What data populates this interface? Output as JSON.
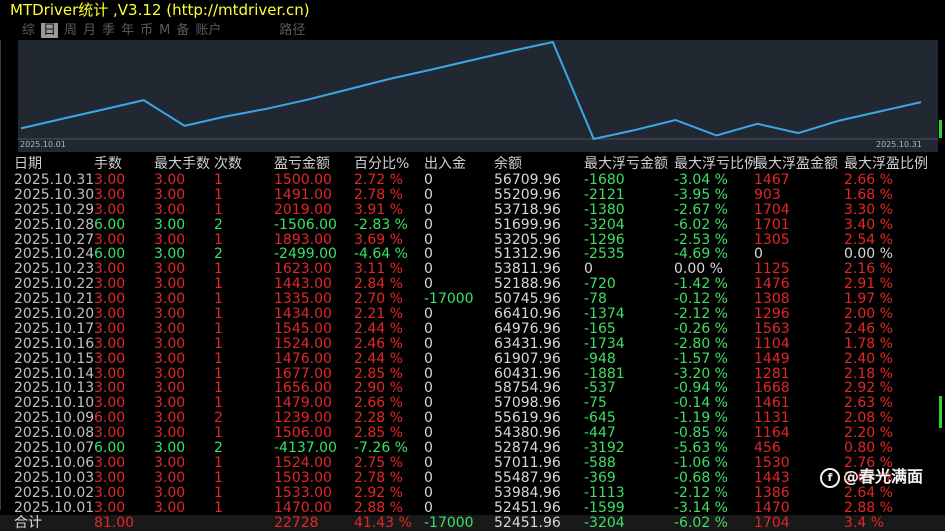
{
  "window": {
    "title": "MTDriver统计 ,V3.12 (http://mtdriver.cn)"
  },
  "tabs": [
    {
      "label": "综",
      "active": false
    },
    {
      "label": "日",
      "active": true
    },
    {
      "label": "周",
      "active": false
    },
    {
      "label": "月",
      "active": false
    },
    {
      "label": "季",
      "active": false
    },
    {
      "label": "年",
      "active": false
    },
    {
      "label": "币",
      "active": false
    },
    {
      "label": "M",
      "active": false
    },
    {
      "label": "备",
      "active": false
    },
    {
      "label": "账户",
      "active": false
    },
    {
      "label": "路径",
      "active": false
    }
  ],
  "chart_data": {
    "type": "line",
    "x_start_label": "2025.10.01",
    "x_end_label": "2025.10.31",
    "color": "#3aa8e8",
    "values": [
      52451.96,
      53984.96,
      55487.96,
      57011.96,
      52874.96,
      54380.96,
      55619.96,
      57098.96,
      58754.96,
      60431.96,
      61907.96,
      63431.96,
      64976.96,
      66410.96,
      50745.96,
      52188.96,
      53811.96,
      51312.96,
      53205.96,
      51699.96,
      53718.96,
      55209.96,
      56709.96
    ]
  },
  "table": {
    "headers": [
      "日期",
      "手数",
      "最大手数",
      "次数",
      "盈亏金额",
      "百分比%",
      "出入金",
      "余额",
      "最大浮亏金额",
      "最大浮亏比例",
      "最大浮盈金额",
      "最大浮盈比例"
    ],
    "rows": [
      {
        "date": "2025.10.31",
        "lots": "3.00",
        "max_lots": "3.00",
        "count": "1",
        "pnl": "1500.00",
        "pct": "2.72 %",
        "io": "0",
        "balance": "56709.96",
        "mfl": "-1680",
        "mflp": "-3.04 %",
        "mfp": "1467",
        "mfpp": "2.66 %",
        "tone": "red"
      },
      {
        "date": "2025.10.30",
        "lots": "3.00",
        "max_lots": "3.00",
        "count": "1",
        "pnl": "1491.00",
        "pct": "2.78 %",
        "io": "0",
        "balance": "55209.96",
        "mfl": "-2121",
        "mflp": "-3.95 %",
        "mfp": "903",
        "mfpp": "1.68 %",
        "tone": "red"
      },
      {
        "date": "2025.10.29",
        "lots": "3.00",
        "max_lots": "3.00",
        "count": "1",
        "pnl": "2019.00",
        "pct": "3.91 %",
        "io": "0",
        "balance": "53718.96",
        "mfl": "-1380",
        "mflp": "-2.67 %",
        "mfp": "1704",
        "mfpp": "3.30 %",
        "tone": "red"
      },
      {
        "date": "2025.10.28",
        "lots": "6.00",
        "max_lots": "3.00",
        "count": "2",
        "pnl": "-1506.00",
        "pct": "-2.83 %",
        "io": "0",
        "balance": "51699.96",
        "mfl": "-3204",
        "mflp": "-6.02 %",
        "mfp": "1701",
        "mfpp": "3.40 %",
        "tone": "green"
      },
      {
        "date": "2025.10.27",
        "lots": "3.00",
        "max_lots": "3.00",
        "count": "1",
        "pnl": "1893.00",
        "pct": "3.69 %",
        "io": "0",
        "balance": "53205.96",
        "mfl": "-1296",
        "mflp": "-2.53 %",
        "mfp": "1305",
        "mfpp": "2.54 %",
        "tone": "red"
      },
      {
        "date": "2025.10.24",
        "lots": "6.00",
        "max_lots": "3.00",
        "count": "2",
        "pnl": "-2499.00",
        "pct": "-4.64 %",
        "io": "0",
        "balance": "51312.96",
        "mfl": "-2535",
        "mflp": "-4.69 %",
        "mfp": "0",
        "mfpp": "0.00 %",
        "tone": "green"
      },
      {
        "date": "2025.10.23",
        "lots": "3.00",
        "max_lots": "3.00",
        "count": "1",
        "pnl": "1623.00",
        "pct": "3.11 %",
        "io": "0",
        "balance": "53811.96",
        "mfl": "0",
        "mflp": "0.00 %",
        "mfp": "1125",
        "mfpp": "2.16 %",
        "tone": "red"
      },
      {
        "date": "2025.10.22",
        "lots": "3.00",
        "max_lots": "3.00",
        "count": "1",
        "pnl": "1443.00",
        "pct": "2.84 %",
        "io": "0",
        "balance": "52188.96",
        "mfl": "-720",
        "mflp": "-1.42 %",
        "mfp": "1476",
        "mfpp": "2.91 %",
        "tone": "red"
      },
      {
        "date": "2025.10.21",
        "lots": "3.00",
        "max_lots": "3.00",
        "count": "1",
        "pnl": "1335.00",
        "pct": "2.70 %",
        "io": "-17000",
        "balance": "50745.96",
        "mfl": "-78",
        "mflp": "-0.12 %",
        "mfp": "1308",
        "mfpp": "1.97 %",
        "tone": "red"
      },
      {
        "date": "2025.10.20",
        "lots": "3.00",
        "max_lots": "3.00",
        "count": "1",
        "pnl": "1434.00",
        "pct": "2.21 %",
        "io": "0",
        "balance": "66410.96",
        "mfl": "-1374",
        "mflp": "-2.12 %",
        "mfp": "1296",
        "mfpp": "2.00 %",
        "tone": "red"
      },
      {
        "date": "2025.10.17",
        "lots": "3.00",
        "max_lots": "3.00",
        "count": "1",
        "pnl": "1545.00",
        "pct": "2.44 %",
        "io": "0",
        "balance": "64976.96",
        "mfl": "-165",
        "mflp": "-0.26 %",
        "mfp": "1563",
        "mfpp": "2.46 %",
        "tone": "red"
      },
      {
        "date": "2025.10.16",
        "lots": "3.00",
        "max_lots": "3.00",
        "count": "1",
        "pnl": "1524.00",
        "pct": "2.46 %",
        "io": "0",
        "balance": "63431.96",
        "mfl": "-1734",
        "mflp": "-2.80 %",
        "mfp": "1104",
        "mfpp": "1.78 %",
        "tone": "red"
      },
      {
        "date": "2025.10.15",
        "lots": "3.00",
        "max_lots": "3.00",
        "count": "1",
        "pnl": "1476.00",
        "pct": "2.44 %",
        "io": "0",
        "balance": "61907.96",
        "mfl": "-948",
        "mflp": "-1.57 %",
        "mfp": "1449",
        "mfpp": "2.40 %",
        "tone": "red"
      },
      {
        "date": "2025.10.14",
        "lots": "3.00",
        "max_lots": "3.00",
        "count": "1",
        "pnl": "1677.00",
        "pct": "2.85 %",
        "io": "0",
        "balance": "60431.96",
        "mfl": "-1881",
        "mflp": "-3.20 %",
        "mfp": "1281",
        "mfpp": "2.18 %",
        "tone": "red"
      },
      {
        "date": "2025.10.13",
        "lots": "3.00",
        "max_lots": "3.00",
        "count": "1",
        "pnl": "1656.00",
        "pct": "2.90 %",
        "io": "0",
        "balance": "58754.96",
        "mfl": "-537",
        "mflp": "-0.94 %",
        "mfp": "1668",
        "mfpp": "2.92 %",
        "tone": "red"
      },
      {
        "date": "2025.10.10",
        "lots": "3.00",
        "max_lots": "3.00",
        "count": "1",
        "pnl": "1479.00",
        "pct": "2.66 %",
        "io": "0",
        "balance": "57098.96",
        "mfl": "-75",
        "mflp": "-0.14 %",
        "mfp": "1461",
        "mfpp": "2.63 %",
        "tone": "red"
      },
      {
        "date": "2025.10.09",
        "lots": "6.00",
        "max_lots": "3.00",
        "count": "2",
        "pnl": "1239.00",
        "pct": "2.28 %",
        "io": "0",
        "balance": "55619.96",
        "mfl": "-645",
        "mflp": "-1.19 %",
        "mfp": "1131",
        "mfpp": "2.08 %",
        "tone": "red"
      },
      {
        "date": "2025.10.08",
        "lots": "3.00",
        "max_lots": "3.00",
        "count": "1",
        "pnl": "1506.00",
        "pct": "2.85 %",
        "io": "0",
        "balance": "54380.96",
        "mfl": "-447",
        "mflp": "-0.85 %",
        "mfp": "1164",
        "mfpp": "2.20 %",
        "tone": "red"
      },
      {
        "date": "2025.10.07",
        "lots": "6.00",
        "max_lots": "3.00",
        "count": "2",
        "pnl": "-4137.00",
        "pct": "-7.26 %",
        "io": "0",
        "balance": "52874.96",
        "mfl": "-3192",
        "mflp": "-5.63 %",
        "mfp": "456",
        "mfpp": "0.80 %",
        "tone": "green"
      },
      {
        "date": "2025.10.06",
        "lots": "3.00",
        "max_lots": "3.00",
        "count": "1",
        "pnl": "1524.00",
        "pct": "2.75 %",
        "io": "0",
        "balance": "57011.96",
        "mfl": "-588",
        "mflp": "-1.06 %",
        "mfp": "1530",
        "mfpp": "2.76 %",
        "tone": "red"
      },
      {
        "date": "2025.10.03",
        "lots": "3.00",
        "max_lots": "3.00",
        "count": "1",
        "pnl": "1503.00",
        "pct": "2.78 %",
        "io": "0",
        "balance": "55487.96",
        "mfl": "-369",
        "mflp": "-0.68 %",
        "mfp": "1443",
        "mfpp": "2.67 %",
        "tone": "red"
      },
      {
        "date": "2025.10.02",
        "lots": "3.00",
        "max_lots": "3.00",
        "count": "1",
        "pnl": "1533.00",
        "pct": "2.92 %",
        "io": "0",
        "balance": "53984.96",
        "mfl": "-1113",
        "mflp": "-2.12 %",
        "mfp": "1386",
        "mfpp": "2.64 %",
        "tone": "red"
      },
      {
        "date": "2025.10.01",
        "lots": "3.00",
        "max_lots": "3.00",
        "count": "1",
        "pnl": "1470.00",
        "pct": "2.88 %",
        "io": "0",
        "balance": "52451.96",
        "mfl": "-1599",
        "mflp": "-3.14 %",
        "mfp": "1470",
        "mfpp": "2.88 %",
        "tone": "red"
      }
    ],
    "total": {
      "label": "合计",
      "lots": "81.00",
      "pnl": "22728",
      "pct": "41.43 %",
      "io": "-17000",
      "balance": "52451.96",
      "mfl": "-3204",
      "mflp": "-6.02 %",
      "mfp": "1704",
      "mfpp": "3.4 %"
    }
  },
  "watermark": {
    "text": "@春光满面"
  },
  "colors": {
    "profit": "#e32727",
    "loss": "#3be064",
    "title": "#ffff33",
    "chart_bg": "#222831"
  }
}
